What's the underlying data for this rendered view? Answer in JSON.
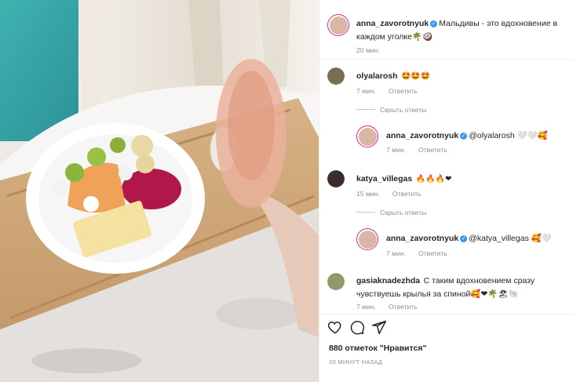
{
  "post": {
    "author": "anna_zavorotnyuk",
    "caption": "Мальдивы - это вдохновение в каждом уголке🌴🥥",
    "caption_time": "20 мин."
  },
  "comments": [
    {
      "user": "olyalarosh",
      "text": "🤩🤩🤩",
      "time": "7 мин.",
      "reply": "Ответить",
      "toggle": "Скрыть ответы",
      "replies": [
        {
          "user": "anna_zavorotnyuk",
          "text": "@olyalarosh 🤍🤍🥰",
          "time": "7 мин.",
          "reply": "Ответить"
        }
      ]
    },
    {
      "user": "katya_villegas",
      "text": "🔥🔥🔥❤",
      "time": "15 мин.",
      "reply": "Ответить",
      "toggle": "Скрыть ответы",
      "replies": [
        {
          "user": "anna_zavorotnyuk",
          "text": "@katya_villegas 🥰🤍",
          "time": "7 мин.",
          "reply": "Ответить"
        }
      ]
    },
    {
      "user": "gasiaknadezhda",
      "text": "С таким вдохновением сразу чувствуешь крылья за спиной🥰❤🌴🏖🐚",
      "time": "7 мин.",
      "reply": "Ответить"
    }
  ],
  "footer": {
    "likes": "880 отметок \"Нравится\"",
    "timestamp": "20 МИНУТ НАЗАД"
  },
  "icons": [
    "heart-icon",
    "comment-icon",
    "share-icon",
    "verified-icon"
  ],
  "colors": {
    "accent": "#3897f0",
    "ring": "#d6249f",
    "meta": "#8e8e8e"
  }
}
